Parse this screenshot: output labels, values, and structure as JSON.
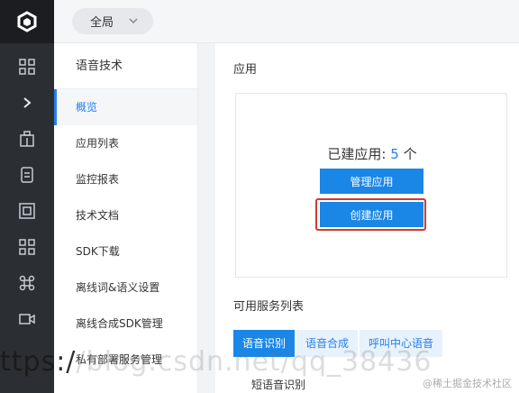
{
  "topbar": {
    "scope_label": "全局"
  },
  "sidebar": {
    "title": "语音技术",
    "items": [
      {
        "label": "概览",
        "active": true
      },
      {
        "label": "应用列表"
      },
      {
        "label": "监控报表"
      },
      {
        "label": "技术文档"
      },
      {
        "label": "SDK下载"
      },
      {
        "label": "离线词&语义设置"
      },
      {
        "label": "离线合成SDK管理"
      },
      {
        "label": "私有部署服务管理"
      }
    ]
  },
  "main": {
    "section_title": "应用",
    "created_prefix": "已建应用:",
    "created_count": "5",
    "created_unit": "个",
    "manage_button": "管理应用",
    "create_button": "创建应用",
    "services_title": "可用服务列表",
    "tabs": [
      {
        "label": "语音识别",
        "active": true
      },
      {
        "label": "语音合成"
      },
      {
        "label": "呼叫中心语音"
      }
    ],
    "first_service": "短语音识别"
  },
  "watermark": {
    "text_left": "ttps:/",
    "text_mid": "/blog.csdn.net/qq_38436",
    "credit": "@稀土掘金技术社区"
  },
  "colors": {
    "accent": "#1a86e6",
    "highlight": "#d23a2e",
    "rail": "#2b2e33"
  }
}
